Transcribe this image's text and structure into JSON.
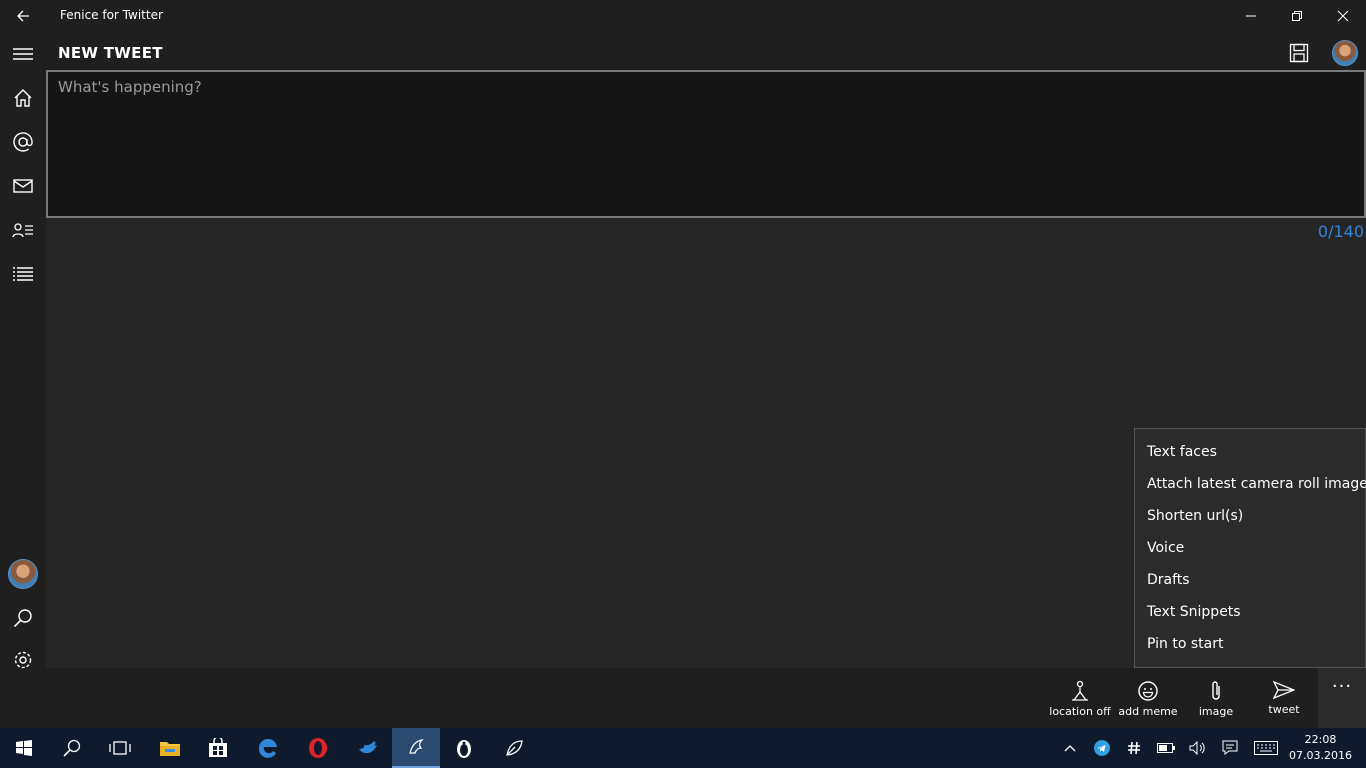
{
  "window": {
    "title": "Fenice for Twitter"
  },
  "header": {
    "title": "NEW TWEET"
  },
  "compose": {
    "placeholder": "What's happening?",
    "value": "",
    "counter": "0/140"
  },
  "menu": {
    "items": [
      "Text faces",
      "Attach latest camera roll image",
      "Shorten url(s)",
      "Voice",
      "Drafts",
      "Text Snippets",
      "Pin to start"
    ]
  },
  "appbar": {
    "location_label": "location off",
    "meme_label": "add meme",
    "image_label": "image",
    "tweet_label": "tweet",
    "more_label": "···"
  },
  "taskbar": {
    "time": "22:08",
    "date": "07.03.2016"
  },
  "colors": {
    "accent": "#2f86d6",
    "background": "#262626",
    "chrome": "#1f1f1f"
  }
}
